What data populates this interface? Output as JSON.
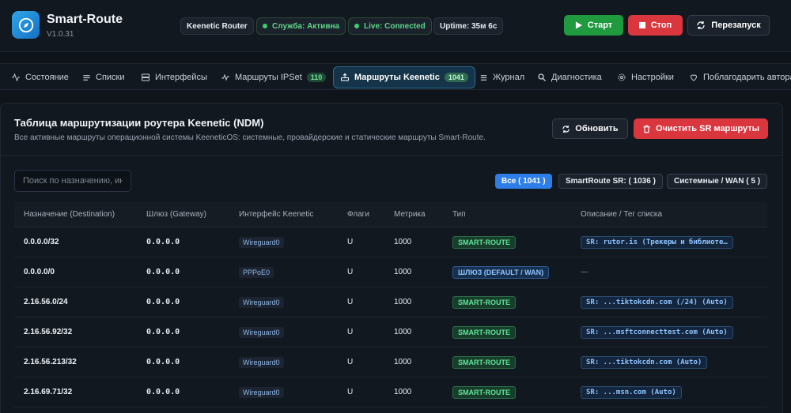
{
  "app": {
    "title": "Smart-Route",
    "version": "V1.0.31"
  },
  "status": {
    "router": "Keenetic Router",
    "service": "Служба: Активна",
    "live": "Live: Connected",
    "uptime": "Uptime: 35м 6с"
  },
  "controls": {
    "start": "Старт",
    "stop": "Стоп",
    "restart": "Перезапуск"
  },
  "nav": {
    "tabs": [
      {
        "label": "Состояние"
      },
      {
        "label": "Списки"
      },
      {
        "label": "Интерфейсы"
      },
      {
        "label": "Маршруты IPSet",
        "badge": "110"
      },
      {
        "label": "Маршруты Keenetic",
        "badge": "1041"
      },
      {
        "label": "Журнал"
      },
      {
        "label": "Диагностика"
      },
      {
        "label": "Настройки"
      },
      {
        "label": "Поблагодарить автора"
      }
    ]
  },
  "panel": {
    "title": "Таблица маршрутизации роутера Keenetic (NDM)",
    "subtitle": "Все активные маршруты операционной системы KeeneticOS: системные, провайдерские и статические маршруты Smart-Route.",
    "refresh": "Обновить",
    "clear": "Очистить SR маршруты",
    "search_placeholder": "Поиск по назначению, интерфейсу",
    "filters": {
      "all": "Все ( 1041 )",
      "smartroute": "SmartRoute SR: ( 1036 )",
      "system": "Системные / WAN ( 5 )"
    }
  },
  "table": {
    "headers": [
      "Назначение (Destination)",
      "Шлюз (Gateway)",
      "Интерфейс Keenetic",
      "Флаги",
      "Метрика",
      "Тип",
      "Описание / Тег списка"
    ],
    "rows": [
      {
        "dest": "0.0.0.0/32",
        "gw": "0.0.0.0",
        "iface": "Wireguard0",
        "flags": "U",
        "metric": "1000",
        "type": "SMART-ROUTE",
        "desc": "SR: rutor.is (Трекеры и библиоте…"
      },
      {
        "dest": "0.0.0.0/0",
        "gw": "0.0.0.0",
        "iface": "PPPoE0",
        "flags": "U",
        "metric": "1000",
        "type": "ШЛЮЗ (DEFAULT / WAN)",
        "desc": "—"
      },
      {
        "dest": "2.16.56.0/24",
        "gw": "0.0.0.0",
        "iface": "Wireguard0",
        "flags": "U",
        "metric": "1000",
        "type": "SMART-ROUTE",
        "desc": "SR: ...tiktokcdn.com (/24) (Auto)"
      },
      {
        "dest": "2.16.56.92/32",
        "gw": "0.0.0.0",
        "iface": "Wireguard0",
        "flags": "U",
        "metric": "1000",
        "type": "SMART-ROUTE",
        "desc": "SR: ...msftconnecttest.com (Auto)"
      },
      {
        "dest": "2.16.56.213/32",
        "gw": "0.0.0.0",
        "iface": "Wireguard0",
        "flags": "U",
        "metric": "1000",
        "type": "SMART-ROUTE",
        "desc": "SR: ...tiktokcdn.com (Auto)"
      },
      {
        "dest": "2.16.69.71/32",
        "gw": "0.0.0.0",
        "iface": "Wireguard0",
        "flags": "U",
        "metric": "1000",
        "type": "SMART-ROUTE",
        "desc": "SR: ...msn.com (Auto)"
      }
    ]
  },
  "colors": {
    "start": "#1f9a3f",
    "stop": "#d9363e",
    "accent": "#2e7ee8",
    "active_tab": "#163449"
  },
  "icons": [
    "compass-icon",
    "play-icon",
    "stop-icon",
    "refresh-icon",
    "activity-icon",
    "list-icon",
    "server-icon",
    "pulse-icon",
    "router-icon",
    "menu-icon",
    "search-icon",
    "gear-icon",
    "heart-icon",
    "trash-icon"
  ]
}
